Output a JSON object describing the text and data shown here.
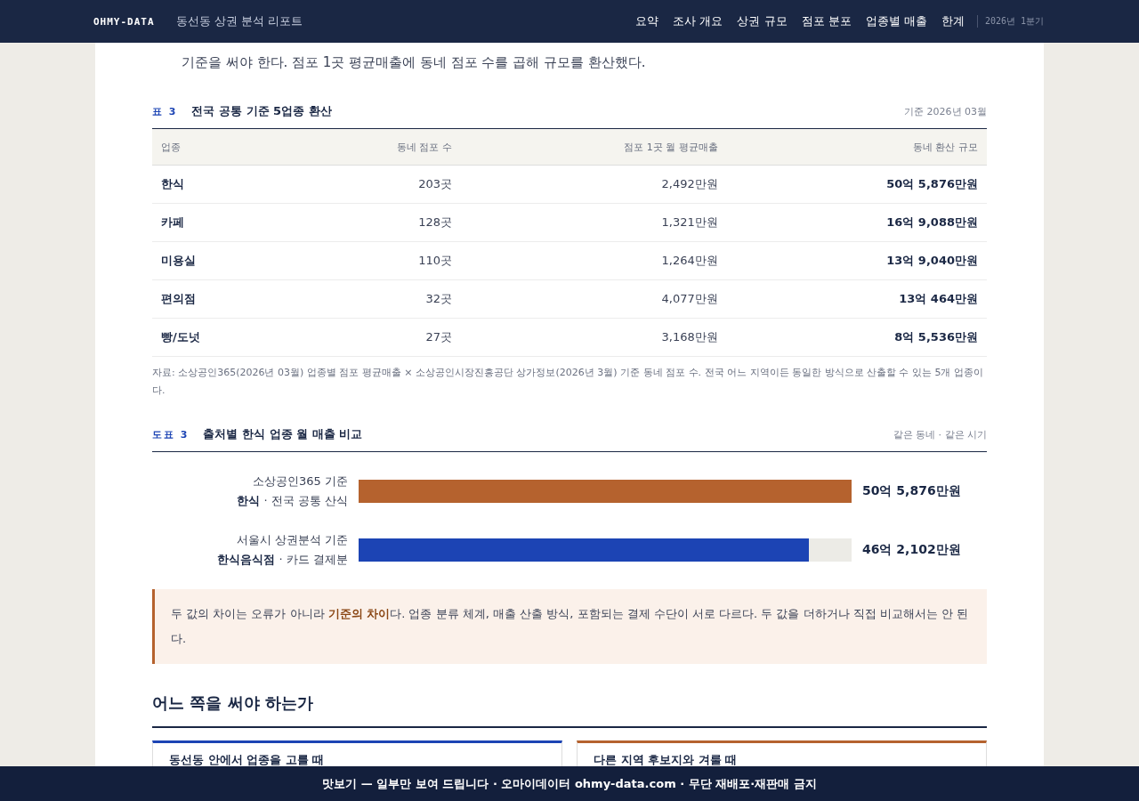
{
  "header": {
    "brand": "OHMY-DATA",
    "title": "동선동 상권 분석 리포트",
    "nav": [
      {
        "label": "요약"
      },
      {
        "label": "조사 개요"
      },
      {
        "label": "상권 규모"
      },
      {
        "label": "점포 분포"
      },
      {
        "label": "업종별 매출"
      },
      {
        "label": "한계"
      }
    ],
    "period": "2026년 1분기"
  },
  "intro": "기준을 써야 한다. 점포 1곳 평균매출에 동네 점포 수를 곱해 규모를 환산했다.",
  "table": {
    "tag": "표 3",
    "title": "전국 공통 기준 5업종 환산",
    "meta": "기준 2026년 03월",
    "columns": [
      "업종",
      "동네 점포 수",
      "점포 1곳 월 평균매출",
      "동네 환산 규모"
    ],
    "rows": [
      [
        "한식",
        "203곳",
        "2,492만원",
        "50억 5,876만원"
      ],
      [
        "카페",
        "128곳",
        "1,321만원",
        "16억 9,088만원"
      ],
      [
        "미용실",
        "110곳",
        "1,264만원",
        "13억 9,040만원"
      ],
      [
        "편의점",
        "32곳",
        "4,077만원",
        "13억 464만원"
      ],
      [
        "빵/도넛",
        "27곳",
        "3,168만원",
        "8억 5,536만원"
      ]
    ],
    "note": "자료: 소상공인365(2026년 03월) 업종별 점포 평균매출 × 소상공인시장진흥공단 상가정보(2026년 3월) 기준 동네 점포 수. 전국 어느 지역이든 동일한 방식으로 산출할 수 있는 5개 업종이다."
  },
  "figure": {
    "tag": "도표 3",
    "title": "출처별 한식 업종 월 매출 비교",
    "meta": "같은 동네 · 같은 시기",
    "bars": [
      {
        "source": "소상공인365 기준",
        "detail": "**한식** · 전국 공통 산식",
        "level": 1.0,
        "color": "#b5622e",
        "value": "50억 5,876만원"
      },
      {
        "source": "서울시 상권분석 기준",
        "detail": "**한식음식점** · 카드 결제분",
        "level": 0.913,
        "color": "#1c44b4",
        "value": "46억 2,102만원"
      }
    ]
  },
  "callout": "두 값의 차이는 오류가 아니라 **기준의 차이**다. 업종 분류 체계, 매출 산출 방식, 포함되는 결제 수단이 서로 다르다. 두 값을 더하거나 직접 비교해서는 안 된다.",
  "section": {
    "heading": "어느 쪽을 써야 하는가",
    "cards": [
      {
        "title": "동선동 안에서 업종을 고를 때",
        "color": "#1c44b4"
      },
      {
        "title": "다른 지역 후보지와 겨룰 때",
        "color": "#b5622e"
      }
    ]
  },
  "banner": "맛보기 — 일부만 보여 드립니다 · 오마이데이터 ohmy-data.com · 무단 재배포·재판매 금지"
}
